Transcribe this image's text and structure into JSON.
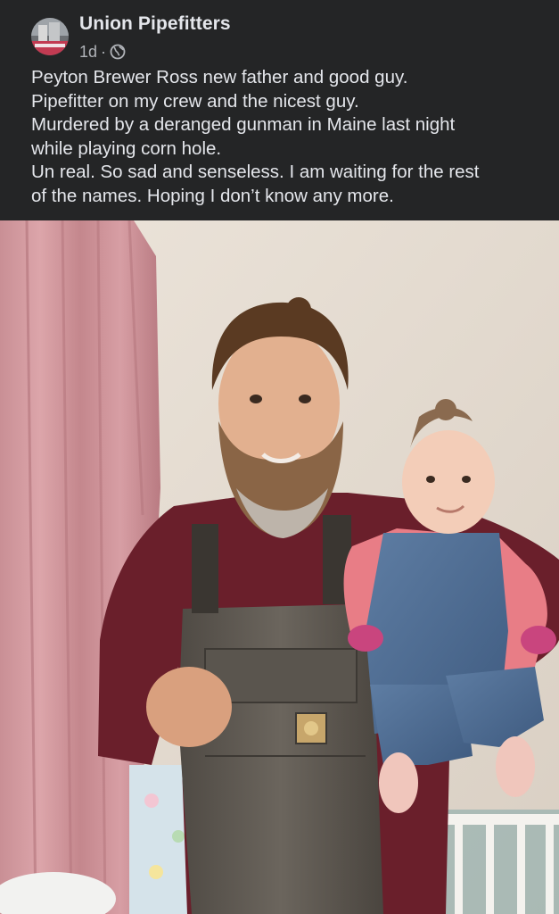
{
  "post": {
    "page_name": "Union Pipefitters",
    "time": "1d",
    "separator": "·",
    "privacy_icon": "globe-icon",
    "text_lines": [
      "Peyton Brewer Ross new father and good guy.",
      "Pipefitter on my crew and the nicest guy.",
      "Murdered by a deranged gunman in Maine last night",
      "while playing corn hole.",
      "Un real. So sad and senseless. I am waiting for the rest",
      "of the names. Hoping I don’t know any more."
    ]
  },
  "colors": {
    "background": "#242526",
    "primary_text": "#e4e6eb",
    "secondary_text": "#b0b3b8"
  },
  "photo": {
    "subject": "photo-man-holding-baby"
  }
}
